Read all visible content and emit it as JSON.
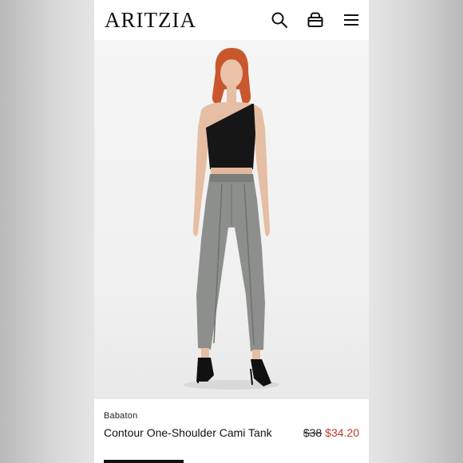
{
  "header": {
    "logo": "ARITZIA",
    "icons": [
      "search-icon",
      "bag-icon",
      "menu-icon"
    ]
  },
  "product": {
    "brand": "Babaton",
    "name": "Contour One-Shoulder Cami Tank",
    "original_price": "$38",
    "sale_price": "$34.20"
  },
  "colors": {
    "sale": "#c0392b",
    "text": "#111111",
    "background": "#ffffff"
  }
}
